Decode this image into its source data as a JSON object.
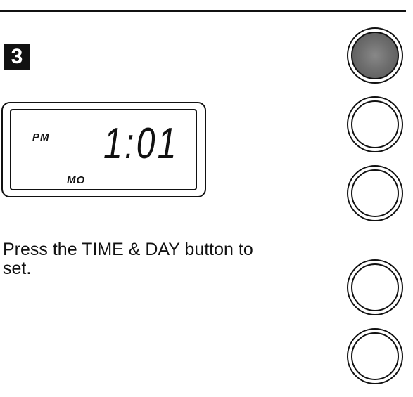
{
  "step": {
    "number": "3"
  },
  "display": {
    "meridiem": "PM",
    "time": "1:01",
    "day": "MO"
  },
  "instruction": {
    "text": "Press the TIME & DAY button to set."
  },
  "control_panel": {
    "buttons": [
      {
        "state": "pressed",
        "fill_color": "#777777"
      },
      {
        "state": "normal"
      },
      {
        "state": "normal"
      },
      {
        "state": "normal"
      },
      {
        "state": "normal"
      }
    ]
  }
}
